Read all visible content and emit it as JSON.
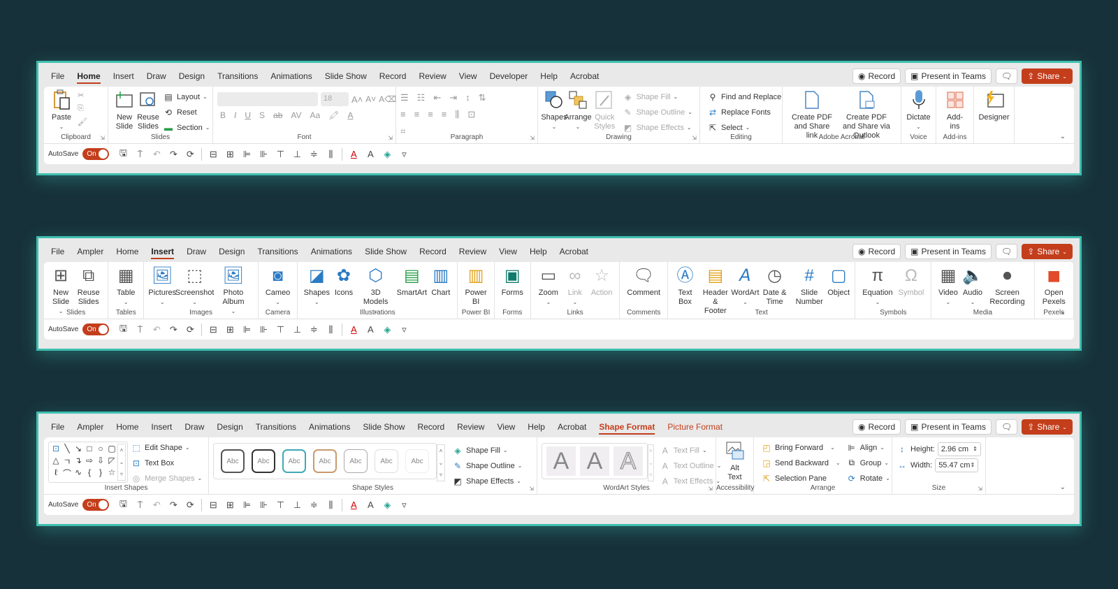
{
  "common": {
    "buttons": {
      "record": "Record",
      "present": "Present in Teams",
      "share": "Share"
    },
    "qat": {
      "autosave": "AutoSave",
      "toggle": "On"
    },
    "colors": {
      "accent": "#c43e1c",
      "frame": "#3fbfb0",
      "background": "#17313a"
    }
  },
  "w1": {
    "tabs": [
      "File",
      "Home",
      "Insert",
      "Draw",
      "Design",
      "Transitions",
      "Animations",
      "Slide Show",
      "Record",
      "Review",
      "View",
      "Developer",
      "Help",
      "Acrobat"
    ],
    "active_tab": "Home",
    "clipboard": {
      "paste": "Paste",
      "label": "Clipboard"
    },
    "slides": {
      "new_slide": "New Slide",
      "reuse": "Reuse Slides",
      "layout": "Layout",
      "reset": "Reset",
      "section": "Section",
      "label": "Slides"
    },
    "font": {
      "size": "18",
      "label": "Font",
      "bold": "B",
      "italic": "I",
      "underline": "U",
      "shadow": "S",
      "strike": "ab",
      "spacing": "AV",
      "case": "Aa"
    },
    "paragraph": {
      "label": "Paragraph"
    },
    "drawing": {
      "shapes": "Shapes",
      "arrange": "Arrange",
      "quick_styles": "Quick Styles",
      "fill": "Shape Fill",
      "outline": "Shape Outline",
      "effects": "Shape Effects",
      "label": "Drawing"
    },
    "editing": {
      "find": "Find and Replace",
      "replace_fonts": "Replace Fonts",
      "select": "Select",
      "label": "Editing"
    },
    "acrobat": {
      "create_pdf": "Create PDF and Share link",
      "create_pdf_outlook": "Create PDF and Share via Outlook",
      "label": "Adobe Acrobat"
    },
    "voice": {
      "dictate": "Dictate",
      "label": "Voice"
    },
    "addins": {
      "addins": "Add-ins",
      "label": "Add-ins"
    },
    "designer": {
      "designer": "Designer"
    }
  },
  "w2": {
    "tabs": [
      "File",
      "Ampler",
      "Home",
      "Insert",
      "Draw",
      "Design",
      "Transitions",
      "Animations",
      "Slide Show",
      "Record",
      "Review",
      "View",
      "Help",
      "Acrobat"
    ],
    "active_tab": "Insert",
    "groups": [
      {
        "label": "Slides",
        "items": [
          "New Slide",
          "Reuse Slides"
        ]
      },
      {
        "label": "Tables",
        "items": [
          "Table"
        ]
      },
      {
        "label": "Images",
        "items": [
          "Pictures",
          "Screenshot",
          "Photo Album"
        ]
      },
      {
        "label": "Camera",
        "items": [
          "Cameo"
        ]
      },
      {
        "label": "Illustrations",
        "items": [
          "Shapes",
          "Icons",
          "3D Models",
          "SmartArt",
          "Chart"
        ]
      },
      {
        "label": "Power BI",
        "items": [
          "Power BI"
        ]
      },
      {
        "label": "Forms",
        "items": [
          "Forms"
        ]
      },
      {
        "label": "Links",
        "items": [
          "Zoom",
          "Link",
          "Action"
        ]
      },
      {
        "label": "Comments",
        "items": [
          "Comment"
        ]
      },
      {
        "label": "Text",
        "items": [
          "Text Box",
          "Header & Footer",
          "WordArt",
          "Date & Time",
          "Slide Number",
          "Object"
        ]
      },
      {
        "label": "Symbols",
        "items": [
          "Equation",
          "Symbol"
        ]
      },
      {
        "label": "Media",
        "items": [
          "Video",
          "Audio",
          "Screen Recording"
        ]
      },
      {
        "label": "Pexels",
        "items": [
          "Open Pexels"
        ]
      }
    ]
  },
  "w3": {
    "tabs": [
      "File",
      "Ampler",
      "Home",
      "Insert",
      "Draw",
      "Design",
      "Transitions",
      "Animations",
      "Slide Show",
      "Record",
      "Review",
      "View",
      "Help",
      "Acrobat"
    ],
    "context_tabs": [
      "Shape Format",
      "Picture Format"
    ],
    "active_tab": "Shape Format",
    "insert_shapes": {
      "edit_shape": "Edit Shape",
      "text_box": "Text Box",
      "merge": "Merge Shapes",
      "label": "Insert Shapes"
    },
    "shape_styles": {
      "sample": "Abc",
      "fill": "Shape Fill",
      "outline": "Shape Outline",
      "effects": "Shape Effects",
      "label": "Shape Styles"
    },
    "wordart": {
      "letter": "A",
      "fill": "Text Fill",
      "outline": "Text Outline",
      "effects": "Text Effects",
      "label": "WordArt Styles"
    },
    "accessibility": {
      "alt_text": "Alt Text",
      "label": "Accessibility"
    },
    "arrange": {
      "bring_forward": "Bring Forward",
      "send_backward": "Send Backward",
      "selection_pane": "Selection Pane",
      "align": "Align",
      "group": "Group",
      "rotate": "Rotate",
      "label": "Arrange"
    },
    "size": {
      "height_label": "Height:",
      "height": "2.96 cm",
      "width_label": "Width:",
      "width": "55.47 cm",
      "label": "Size"
    }
  }
}
